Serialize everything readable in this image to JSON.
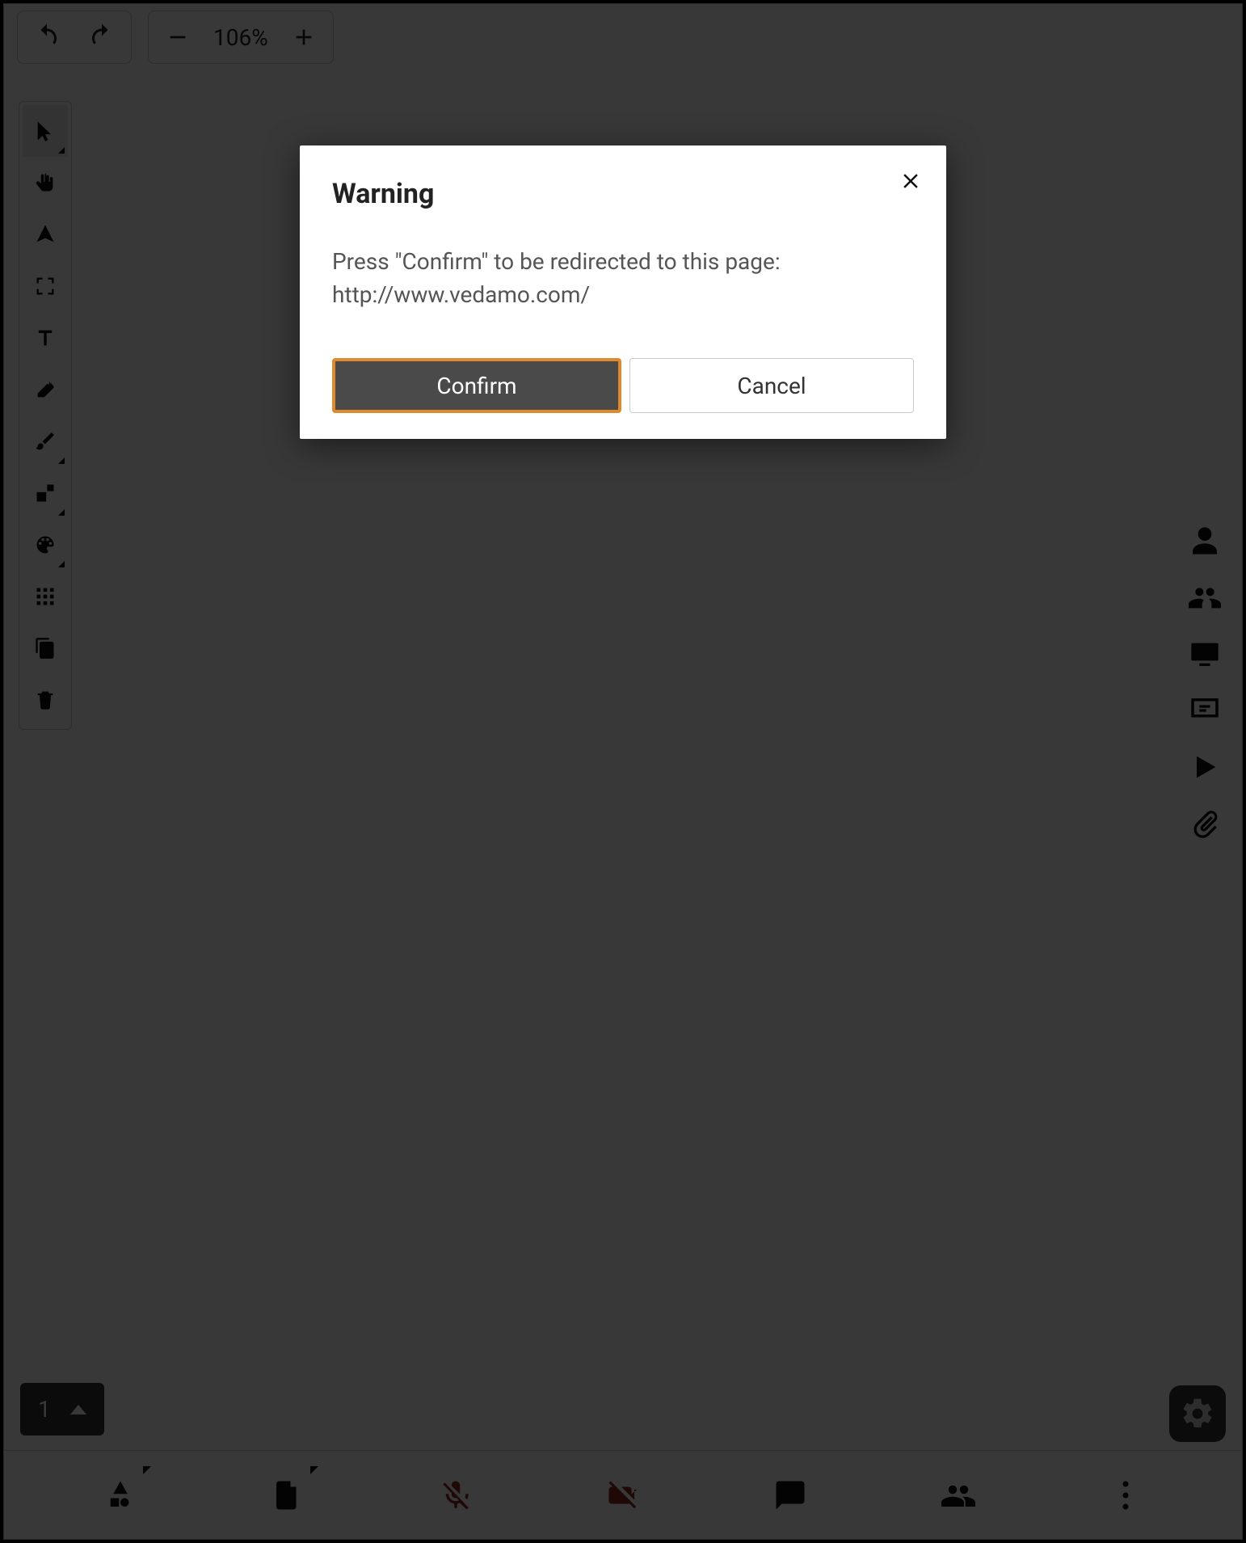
{
  "topbar": {
    "zoom_label": "106%"
  },
  "left_tools": [
    {
      "name": "pointer-icon",
      "active": true,
      "submenu": true
    },
    {
      "name": "hand-icon",
      "active": false,
      "submenu": false
    },
    {
      "name": "laser-icon",
      "active": false,
      "submenu": false
    },
    {
      "name": "fit-icon",
      "active": false,
      "submenu": false
    },
    {
      "name": "text-icon",
      "active": false,
      "submenu": false
    },
    {
      "name": "eraser-icon",
      "active": false,
      "submenu": false
    },
    {
      "name": "brush-icon",
      "active": false,
      "submenu": true
    },
    {
      "name": "shape-icon",
      "active": false,
      "submenu": true
    },
    {
      "name": "palette-icon",
      "active": false,
      "submenu": true
    },
    {
      "name": "grid-icon",
      "active": false,
      "submenu": false
    },
    {
      "name": "copy-icon",
      "active": false,
      "submenu": false
    },
    {
      "name": "trash-icon",
      "active": false,
      "submenu": false
    }
  ],
  "right_icons": [
    "user-icon",
    "group-icon",
    "monitor-icon",
    "presentation-icon",
    "play-icon",
    "attachment-icon"
  ],
  "page_selector": {
    "current": "1"
  },
  "bottom_icons": [
    {
      "name": "shapes-icon",
      "muted": false,
      "submenu": true
    },
    {
      "name": "file-icon",
      "muted": false,
      "submenu": true
    },
    {
      "name": "mic-off-icon",
      "muted": true,
      "submenu": false
    },
    {
      "name": "camera-off-icon",
      "muted": true,
      "submenu": false
    },
    {
      "name": "chat-icon",
      "muted": false,
      "submenu": false
    },
    {
      "name": "people-icon",
      "muted": false,
      "submenu": false
    },
    {
      "name": "more-icon",
      "muted": false,
      "submenu": false
    }
  ],
  "modal": {
    "title": "Warning",
    "body_line1": "Press \"Confirm\" to be redirected to this page:",
    "body_line2": "http://www.vedamo.com/",
    "confirm_label": "Confirm",
    "cancel_label": "Cancel"
  }
}
